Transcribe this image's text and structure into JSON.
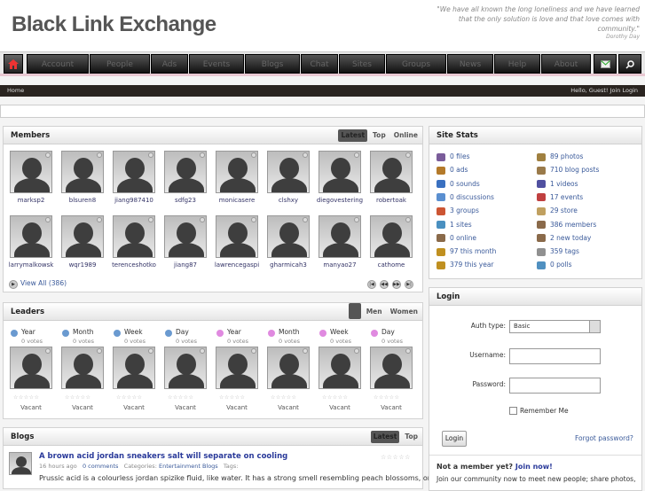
{
  "header": {
    "logo": "Black Link Exchange",
    "quote": "\"We have all known the long loneliness and we have learned that the only solution is love and that love comes with community.\"",
    "quote_author": "Dorothy Day"
  },
  "nav": {
    "items": [
      "Account",
      "People",
      "Ads",
      "Events",
      "Blogs",
      "Chat",
      "Sites",
      "Groups",
      "News",
      "Help",
      "About"
    ]
  },
  "subbar": {
    "breadcrumb": "Home",
    "greeting": "Hello, Guest! Join Login"
  },
  "members": {
    "title": "Members",
    "tabs": [
      "Latest",
      "Top",
      "Online"
    ],
    "row1": [
      "marksp2",
      "blsuren8",
      "jiang987410",
      "sdfg23",
      "monicasere",
      "clshxy",
      "diegovestering",
      "robertoak"
    ],
    "row2": [
      "larrymalkowsk",
      "wqr1989",
      "terenceshotko",
      "jiang87",
      "lawrencegaspi",
      "gharmicah3",
      "manyao27",
      "cathome"
    ],
    "view_all": "View All (386)"
  },
  "leaders": {
    "title": "Leaders",
    "tabs": [
      "",
      "Men",
      "Women"
    ],
    "periods": [
      "Year",
      "Month",
      "Week",
      "Day",
      "Year",
      "Month",
      "Week",
      "Day"
    ],
    "votes": "0 votes",
    "stars": "☆☆☆☆☆",
    "vacant": "Vacant"
  },
  "blogs": {
    "title": "Blogs",
    "tabs": [
      "Latest",
      "Top"
    ],
    "post_title": "A brown acid jordan sneakers salt will separate on cooling",
    "post_meta_time": "16 hours ago",
    "post_meta_comments": "0 comments",
    "post_meta_cat_label": "Categories:",
    "post_meta_cat": "Entertainment Blogs",
    "post_meta_tags": "Tags:",
    "post_excerpt": "Prussic acid is a colourless jordan spizike fluid, like water. It has a strong smell resembling peach blossoms, or bitter ..."
  },
  "stats": {
    "title": "Site Stats",
    "left": [
      "0 files",
      "0 ads",
      "0 sounds",
      "0 discussions",
      "3 groups",
      "1 sites",
      "0 online",
      "97 this month",
      "379 this year"
    ],
    "right": [
      "89 photos",
      "710 blog posts",
      "1 videos",
      "17 events",
      "29 store",
      "386 members",
      "2 new today",
      "359 tags",
      "0 polls"
    ],
    "colors_left": [
      "#7a5c9a",
      "#b47a2a",
      "#3a70c0",
      "#5a8fd0",
      "#cc5533",
      "#4a90c0",
      "#8a6a4a",
      "#c09020",
      "#c09020"
    ],
    "colors_right": [
      "#a08040",
      "#9a7a4a",
      "#5050a0",
      "#c04040",
      "#c0a060",
      "#8a6a4a",
      "#8a6a4a",
      "#909090",
      "#5090c0"
    ]
  },
  "login": {
    "title": "Login",
    "auth_label": "Auth type:",
    "auth_value": "Basic",
    "username_label": "Username:",
    "password_label": "Password:",
    "remember": "Remember Me",
    "login_btn": "Login",
    "forgot": "Forgot password?",
    "not_member": "Not a member yet?",
    "join": "Join now!",
    "join_text": "Join our community now to meet new people; share photos,"
  }
}
